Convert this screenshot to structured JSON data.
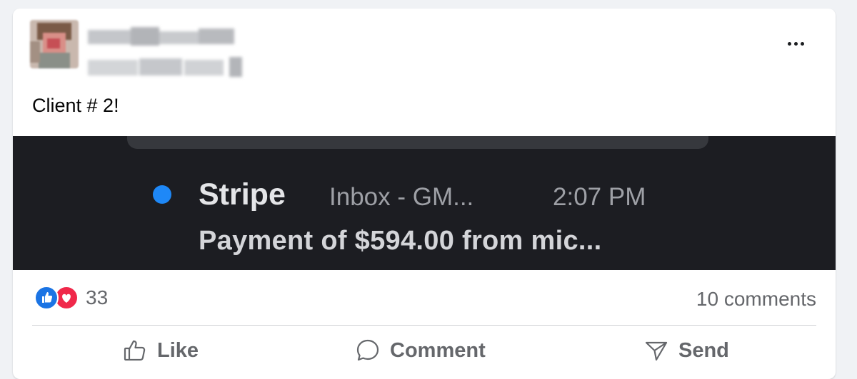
{
  "post": {
    "text": "Client # 2!",
    "more_icon": "more-horizontal-icon"
  },
  "notification": {
    "sender": "Stripe",
    "mailbox": "Inbox - GM...",
    "time": "2:07 PM",
    "body": "Payment of $594.00 from mic...",
    "unread_dot_color": "#1e88f7"
  },
  "reactions": {
    "count": "33",
    "icons": [
      "like-reaction-icon",
      "love-reaction-icon"
    ]
  },
  "comments": {
    "label": "10 comments"
  },
  "actions": {
    "like": "Like",
    "comment": "Comment",
    "send": "Send"
  },
  "colors": {
    "like_blue": "#1b74e4",
    "love_red": "#f0284a",
    "secondary_text": "#65676b"
  }
}
